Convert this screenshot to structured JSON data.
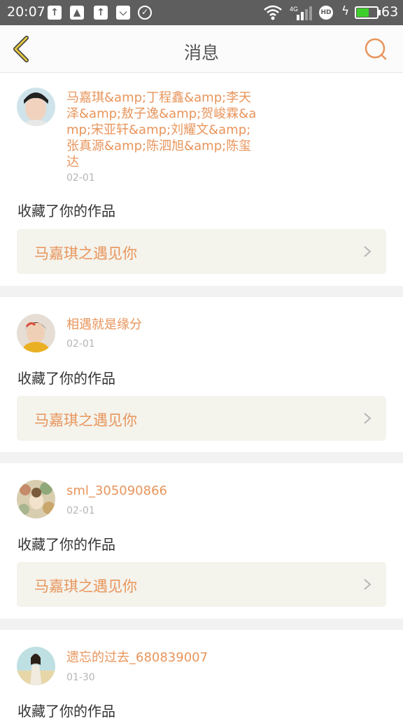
{
  "status_bar": {
    "time": "20:07",
    "icons": [
      "upload-icon",
      "image-icon",
      "upload-icon",
      "pocket-icon",
      "check-circle-icon"
    ],
    "network": "4G",
    "battery_percent": "63",
    "battery_level": 0.63
  },
  "nav": {
    "title": "消息",
    "back_icon": "chevron-left-icon",
    "search_icon": "search-icon",
    "accent": "#e8955c",
    "back_color": "#c7a72b"
  },
  "notifications": [
    {
      "user": "马嘉琪&amp;丁程鑫&amp;李天泽&amp;敖子逸&amp;贺峻霖&amp;宋亚轩&amp;刘耀文&amp;张真源&amp;陈泗旭&amp;陈玺达",
      "date": "02-01",
      "action": "收藏了你的作品",
      "work": "马嘉琪之遇见你"
    },
    {
      "user": "相遇就是缘分",
      "date": "02-01",
      "action": "收藏了你的作品",
      "work": "马嘉琪之遇见你"
    },
    {
      "user": "sml_305090866",
      "date": "02-01",
      "action": "收藏了你的作品",
      "work": "马嘉琪之遇见你"
    },
    {
      "user": "遗忘的过去_680839007",
      "date": "01-30",
      "action": "收藏了你的作品",
      "work": ""
    }
  ]
}
